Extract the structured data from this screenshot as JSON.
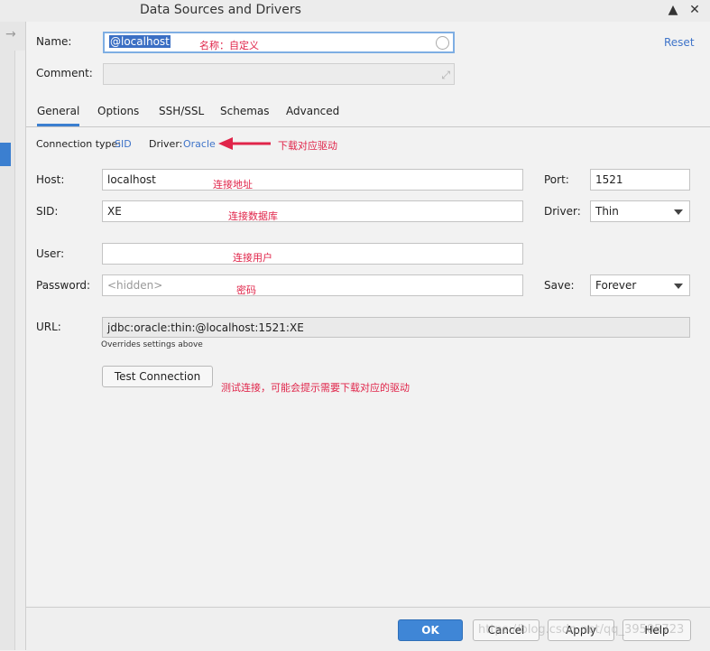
{
  "window": {
    "title": "Data Sources and Drivers"
  },
  "header": {
    "name_label": "Name:",
    "name_value": "@localhost",
    "name_annotation": "名称：自定义",
    "comment_label": "Comment:",
    "reset_label": "Reset"
  },
  "tabs": [
    {
      "label": "General"
    },
    {
      "label": "Options"
    },
    {
      "label": "SSH/SSL"
    },
    {
      "label": "Schemas"
    },
    {
      "label": "Advanced"
    }
  ],
  "connection": {
    "type_label": "Connection type:",
    "type_value": "SID",
    "driver_label": "Driver:",
    "driver_value": "Oracle",
    "driver_annotation": "下载对应驱动"
  },
  "fields": {
    "host_label": "Host:",
    "host_value": "localhost",
    "host_annotation": "连接地址",
    "port_label": "Port:",
    "port_value": "1521",
    "sid_label": "SID:",
    "sid_value": "XE",
    "sid_annotation": "连接数据库",
    "driver_label": "Driver:",
    "driver_value": "Thin",
    "user_label": "User:",
    "user_value": "",
    "user_annotation": "连接用户",
    "password_label": "Password:",
    "password_placeholder": "<hidden>",
    "password_annotation": "密码",
    "save_label": "Save:",
    "save_value": "Forever",
    "url_label": "URL:",
    "url_value": "jdbc:oracle:thin:@localhost:1521:XE",
    "url_note": "Overrides settings above"
  },
  "test": {
    "button_label": "Test Connection",
    "annotation": "测试连接，可能会提示需要下载对应的驱动"
  },
  "footer": {
    "ok": "OK",
    "cancel": "Cancel",
    "apply": "Apply",
    "help": "Help"
  },
  "watermark": "https://blog.csdn.net/qq_39505723",
  "colors": {
    "accent": "#3b7fd0",
    "annotation": "#e0254a",
    "link": "#3f74c9"
  }
}
